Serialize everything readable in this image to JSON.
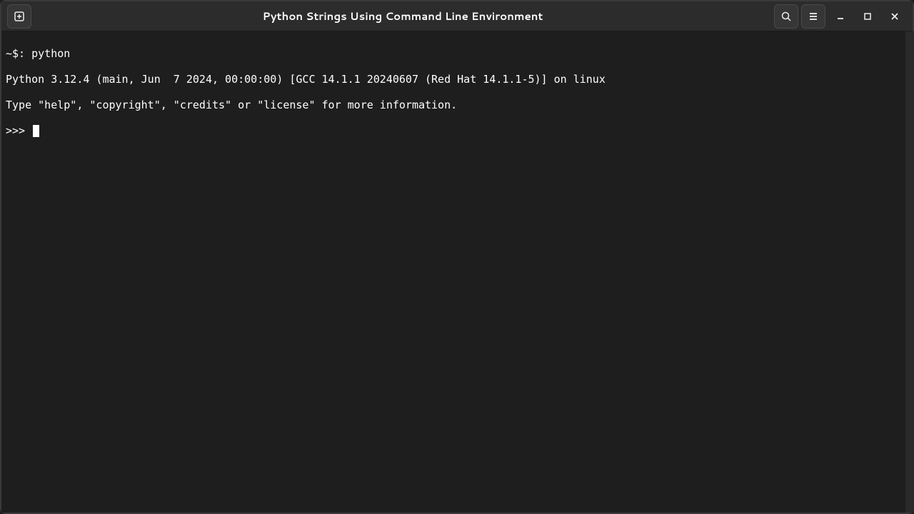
{
  "window": {
    "title": "Python Strings Using Command Line Environment"
  },
  "terminal": {
    "shell_prompt": "~$: python",
    "python_version_line": "Python 3.12.4 (main, Jun  7 2024, 00:00:00) [GCC 14.1.1 20240607 (Red Hat 14.1.1-5)] on linux",
    "help_line": "Type \"help\", \"copyright\", \"credits\" or \"license\" for more information.",
    "repl_prompt": ">>> "
  }
}
